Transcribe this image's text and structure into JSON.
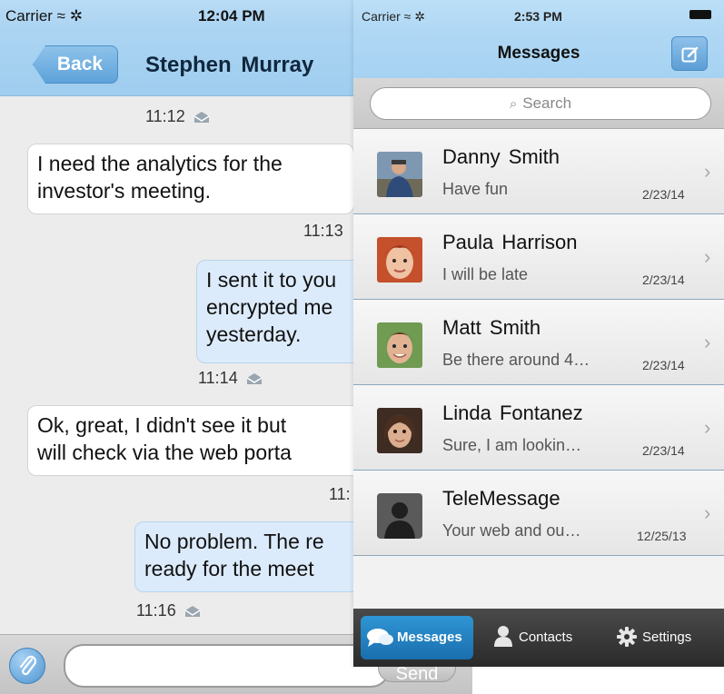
{
  "colors": {
    "nav_blue": "#a6d2f2",
    "accent_blue": "#5ea2d9",
    "outgoing_bubble": "#dcebfb",
    "tab_active": "#2f95d4"
  },
  "chat": {
    "status": {
      "carrier": "Carrier ≈ ✲",
      "time": "12:04 PM"
    },
    "back_label": "Back",
    "title": "Stephen  Murray",
    "messages": [
      {
        "dir": "stamp",
        "time": "11:12"
      },
      {
        "dir": "in",
        "text_lines": [
          "I need the analytics for the",
          "investor's meeting."
        ],
        "time": "11:13"
      },
      {
        "dir": "out",
        "text_lines": [
          "I sent it to you",
          "encrypted me",
          "yesterday."
        ],
        "time": "11:14"
      },
      {
        "dir": "in",
        "text_lines": [
          "Ok, great, I didn't see it but",
          "will check via the web porta"
        ],
        "time": "11:"
      },
      {
        "dir": "out",
        "text_lines": [
          "No problem. The re",
          "ready for the meet"
        ],
        "time": "11:16"
      }
    ],
    "input_placeholder": "",
    "send_label": "Send",
    "icons": {
      "attach": "paperclip-icon",
      "read": "envelope-open-icon"
    }
  },
  "list": {
    "status": {
      "carrier": "Carrier ≈ ✲",
      "time": "2:53 PM"
    },
    "title": "Messages",
    "search_placeholder": "Search",
    "conversations": [
      {
        "name": "Danny  Smith",
        "preview": "Have fun",
        "date": "2/23/14",
        "avatar": "photo-danny"
      },
      {
        "name": "Paula Harrison",
        "preview": "I will be late",
        "date": "2/23/14",
        "avatar": "photo-paula"
      },
      {
        "name": "Matt Smith",
        "preview": "Be there around 4…",
        "date": "2/23/14",
        "avatar": "photo-matt"
      },
      {
        "name": "Linda Fontanez",
        "preview": "Sure, I am lookin…",
        "date": "2/23/14",
        "avatar": "photo-linda"
      },
      {
        "name": "TeleMessage",
        "preview": "Your web and ou…",
        "date": "12/25/13",
        "avatar": "silhouette"
      }
    ],
    "tabs": [
      {
        "label": "Messages",
        "icon": "speech-bubbles-icon",
        "active": true
      },
      {
        "label": "Contacts",
        "icon": "person-icon",
        "active": false
      },
      {
        "label": "Settings",
        "icon": "gear-icon",
        "active": false
      }
    ]
  }
}
